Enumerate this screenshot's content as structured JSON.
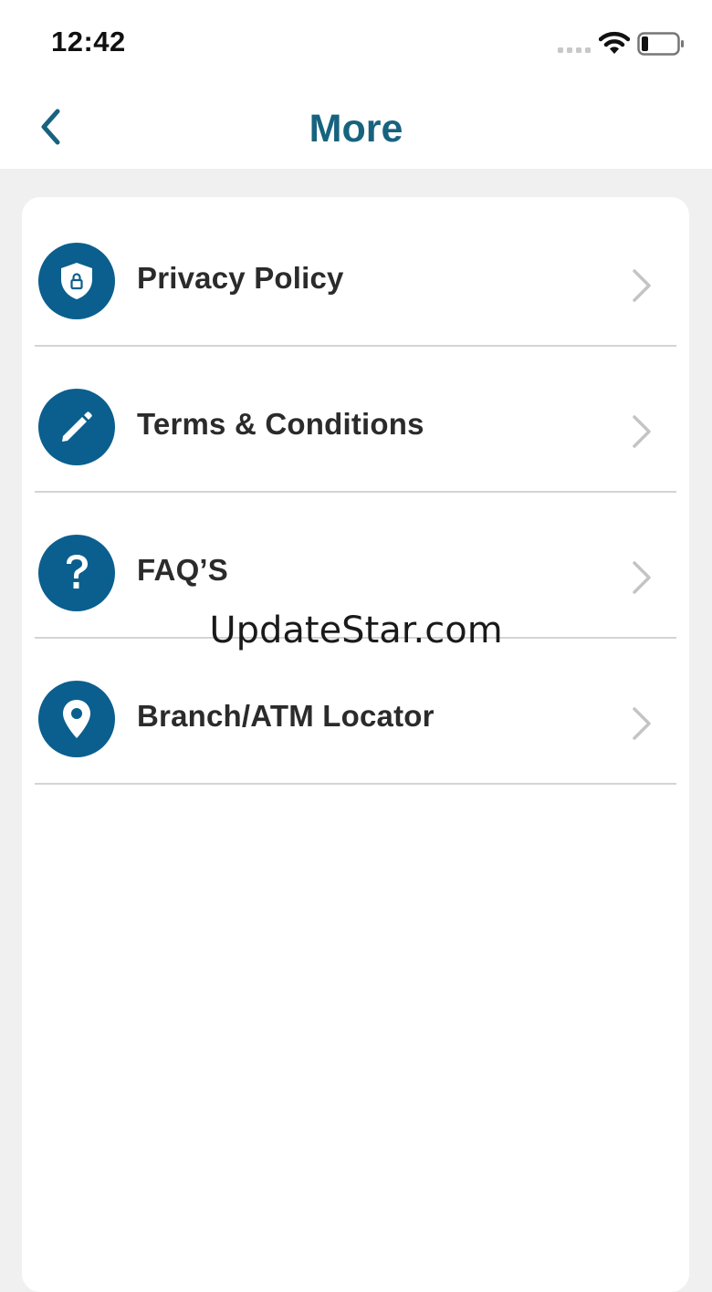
{
  "status_bar": {
    "time": "12:42",
    "icons": [
      "signal-icon",
      "wifi-icon",
      "battery-icon"
    ]
  },
  "nav": {
    "title": "More",
    "back_icon": "chevron-left-icon"
  },
  "menu": {
    "items": [
      {
        "label": "Privacy Policy",
        "icon": "shield-lock-icon"
      },
      {
        "label": "Terms & Conditions",
        "icon": "pencil-icon"
      },
      {
        "label": "FAQ’S",
        "icon": "question-icon"
      },
      {
        "label": "Branch/ATM Locator",
        "icon": "location-pin-icon"
      }
    ]
  },
  "watermark": "UpdateStar.com",
  "colors": {
    "accent": "#0a5f8e",
    "title": "#17637f",
    "background": "#f0f0f0",
    "card": "#ffffff",
    "chevron": "#c4c4c4"
  }
}
